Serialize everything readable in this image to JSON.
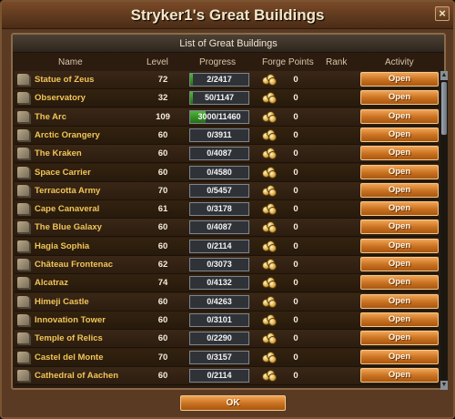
{
  "window": {
    "title": "Stryker1's Great Buildings",
    "close_label": "×",
    "ok_label": "OK"
  },
  "panel": {
    "header": "List of Great Buildings",
    "columns": {
      "name": "Name",
      "level": "Level",
      "progress": "Progress",
      "forge_points": "Forge Points",
      "rank": "Rank",
      "activity": "Activity"
    }
  },
  "icons": {
    "building": "building-icon",
    "forge_points": "forge-points-icon"
  },
  "colors": {
    "name_text": "#f2c558",
    "button_orange": "#c8701f",
    "progress_green": "#4fb53a"
  },
  "buildings": [
    {
      "name": "Statue of Zeus",
      "level": "72",
      "progress": "2/2417",
      "fp": "0",
      "rank": "",
      "action": "Open",
      "fill": 0.0008
    },
    {
      "name": "Observatory",
      "level": "32",
      "progress": "50/1147",
      "fp": "0",
      "rank": "",
      "action": "Open",
      "fill": 0.044
    },
    {
      "name": "The Arc",
      "level": "109",
      "progress": "3000/11460",
      "fp": "0",
      "rank": "",
      "action": "Open",
      "fill": 0.262
    },
    {
      "name": "Arctic Orangery",
      "level": "60",
      "progress": "0/3911",
      "fp": "0",
      "rank": "",
      "action": "Open",
      "fill": 0
    },
    {
      "name": "The Kraken",
      "level": "60",
      "progress": "0/4087",
      "fp": "0",
      "rank": "",
      "action": "Open",
      "fill": 0
    },
    {
      "name": "Space Carrier",
      "level": "60",
      "progress": "0/4580",
      "fp": "0",
      "rank": "",
      "action": "Open",
      "fill": 0
    },
    {
      "name": "Terracotta Army",
      "level": "70",
      "progress": "0/5457",
      "fp": "0",
      "rank": "",
      "action": "Open",
      "fill": 0
    },
    {
      "name": "Cape Canaveral",
      "level": "61",
      "progress": "0/3178",
      "fp": "0",
      "rank": "",
      "action": "Open",
      "fill": 0
    },
    {
      "name": "The Blue Galaxy",
      "level": "60",
      "progress": "0/4087",
      "fp": "0",
      "rank": "",
      "action": "Open",
      "fill": 0
    },
    {
      "name": "Hagia Sophia",
      "level": "60",
      "progress": "0/2114",
      "fp": "0",
      "rank": "",
      "action": "Open",
      "fill": 0
    },
    {
      "name": "Château Frontenac",
      "level": "62",
      "progress": "0/3073",
      "fp": "0",
      "rank": "",
      "action": "Open",
      "fill": 0
    },
    {
      "name": "Alcatraz",
      "level": "74",
      "progress": "0/4132",
      "fp": "0",
      "rank": "",
      "action": "Open",
      "fill": 0
    },
    {
      "name": "Himeji Castle",
      "level": "60",
      "progress": "0/4263",
      "fp": "0",
      "rank": "",
      "action": "Open",
      "fill": 0
    },
    {
      "name": "Innovation Tower",
      "level": "60",
      "progress": "0/3101",
      "fp": "0",
      "rank": "",
      "action": "Open",
      "fill": 0
    },
    {
      "name": "Temple of Relics",
      "level": "60",
      "progress": "0/2290",
      "fp": "0",
      "rank": "",
      "action": "Open",
      "fill": 0
    },
    {
      "name": "Castel del Monte",
      "level": "70",
      "progress": "0/3157",
      "fp": "0",
      "rank": "",
      "action": "Open",
      "fill": 0
    },
    {
      "name": "Cathedral of Aachen",
      "level": "60",
      "progress": "0/2114",
      "fp": "0",
      "rank": "",
      "action": "Open",
      "fill": 0
    }
  ]
}
